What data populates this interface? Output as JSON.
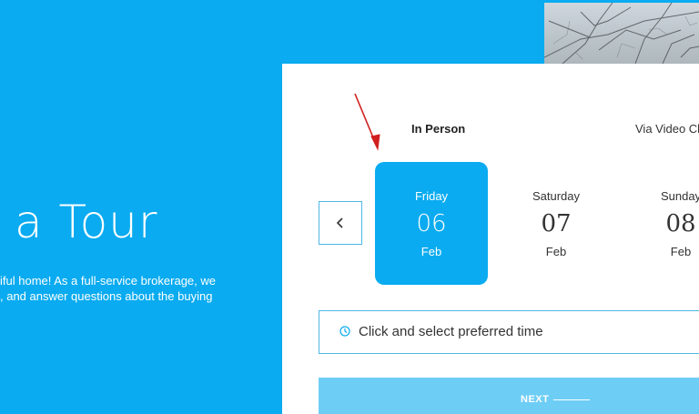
{
  "hero": {
    "title": "a Tour",
    "text_line1": "iful home! As a full-service brokerage, we",
    "text_line2": ", and answer questions about the buying"
  },
  "tabs": [
    {
      "label": "In Person",
      "active": true
    },
    {
      "label": "Via Video Ch",
      "active": false
    }
  ],
  "days": [
    {
      "name": "Friday",
      "number": "06",
      "month": "Feb",
      "selected": true
    },
    {
      "name": "Saturday",
      "number": "07",
      "month": "Feb",
      "selected": false
    },
    {
      "name": "Sunday",
      "number": "08",
      "month": "Feb",
      "selected": false
    }
  ],
  "prev_button": {
    "icon": "chevron-left-icon"
  },
  "time_select": {
    "icon": "clock-icon",
    "label": "Click and select preferred time"
  },
  "next_button": {
    "label": "NEXT"
  },
  "colors": {
    "accent": "#0aabf0",
    "border": "#4fb8e8",
    "next_button": "#6ecdf5",
    "annotation_arrow": "#d11f1f",
    "top_strip": "#1c5fa8"
  }
}
